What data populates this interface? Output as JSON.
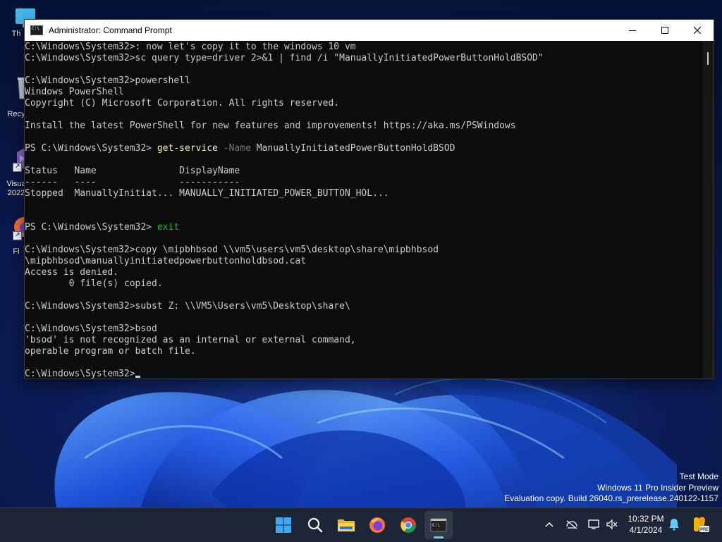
{
  "desktop": {
    "icons": [
      {
        "label": "Th",
        "icon": "this-pc-icon"
      },
      {
        "label": "Recy",
        "icon": "recycle-bin-icon"
      },
      {
        "label": "Visua",
        "label2": "2022",
        "icon": "visual-studio-icon"
      },
      {
        "label": "Fi",
        "icon": "firefox-icon"
      }
    ]
  },
  "window": {
    "title": "Administrator: Command Prompt",
    "terminal_lines": [
      [
        {
          "t": "C:\\Windows\\System32>: now let's copy it to the windows 10 vm"
        }
      ],
      [
        {
          "t": "C:\\Windows\\System32>sc query type=driver 2>&1 | find /i \"ManuallyInitiatedPowerButtonHoldBSOD\""
        }
      ],
      [
        {
          "t": ""
        }
      ],
      [
        {
          "t": "C:\\Windows\\System32>powershell"
        }
      ],
      [
        {
          "t": "Windows PowerShell"
        }
      ],
      [
        {
          "t": "Copyright (C) Microsoft Corporation. All rights reserved."
        }
      ],
      [
        {
          "t": ""
        }
      ],
      [
        {
          "t": "Install the latest PowerShell for new features and improvements! https://aka.ms/PSWindows"
        }
      ],
      [
        {
          "t": ""
        }
      ],
      [
        {
          "t": "PS C:\\Windows\\System32> "
        },
        {
          "t": "get-service",
          "c": "yellow"
        },
        {
          "t": " -Name",
          "c": "gray"
        },
        {
          "t": " ManuallyInitiatedPowerButtonHoldBSOD"
        }
      ],
      [
        {
          "t": ""
        }
      ],
      [
        {
          "t": "Status   Name               DisplayName"
        }
      ],
      [
        {
          "t": "------   ----               -----------"
        }
      ],
      [
        {
          "t": "Stopped  ManuallyInitiat... MANUALLY_INITIATED_POWER_BUTTON_HOL..."
        }
      ],
      [
        {
          "t": ""
        }
      ],
      [
        {
          "t": ""
        }
      ],
      [
        {
          "t": "PS C:\\Windows\\System32> "
        },
        {
          "t": "exit",
          "c": "green"
        }
      ],
      [
        {
          "t": ""
        }
      ],
      [
        {
          "t": "C:\\Windows\\System32>copy \\mipbhbsod \\\\vm5\\users\\vm5\\desktop\\share\\mipbhbsod"
        }
      ],
      [
        {
          "t": "\\mipbhbsod\\manuallyinitiatedpowerbuttonholdbsod.cat"
        }
      ],
      [
        {
          "t": "Access is denied."
        }
      ],
      [
        {
          "t": "        0 file(s) copied."
        }
      ],
      [
        {
          "t": ""
        }
      ],
      [
        {
          "t": "C:\\Windows\\System32>subst Z: \\\\VM5\\Users\\vm5\\Desktop\\share\\"
        }
      ],
      [
        {
          "t": ""
        }
      ],
      [
        {
          "t": "C:\\Windows\\System32>bsod"
        }
      ],
      [
        {
          "t": "'bsod' is not recognized as an internal or external command,"
        }
      ],
      [
        {
          "t": "operable program or batch file."
        }
      ],
      [
        {
          "t": ""
        }
      ],
      [
        {
          "t": "C:\\Windows\\System32>",
          "cursor": true
        }
      ]
    ]
  },
  "watermark": {
    "line1": "Test Mode",
    "line2": "Windows 11 Pro Insider Preview",
    "line3": "Evaluation copy. Build 26040.rs_prerelease.240122-1157"
  },
  "taskbar": {
    "apps": [
      "start-icon",
      "search-icon",
      "file-explorer-icon",
      "firefox-icon",
      "chrome-icon",
      "terminal-icon"
    ],
    "active_app": "terminal-icon",
    "tray": [
      "chevron-up-icon",
      "network-icon",
      "display-icon",
      "volume-icon"
    ],
    "time": "10:32 PM",
    "date": "4/1/2024",
    "notification_icon": "bell-icon",
    "copilot_badge": "PRE"
  },
  "colors": {
    "terminal_bg": "#0c0c0c",
    "terminal_text": "#cccccc",
    "command_yellow": "#f9f1a5",
    "param_gray": "#767676",
    "keyword_green": "#16c60c",
    "taskbar_bg": "#1c2636",
    "accent": "#60cdff"
  }
}
